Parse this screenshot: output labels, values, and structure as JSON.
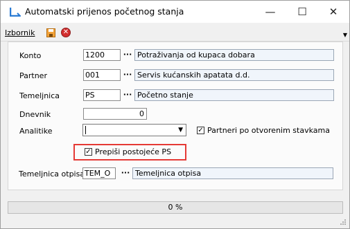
{
  "window": {
    "title": "Automatski prijenos početnog stanja"
  },
  "titlebar": {
    "minimize": "—",
    "maximize": "☐",
    "close": "✕"
  },
  "menu": {
    "izbornik": "Izbornik"
  },
  "form": {
    "konto": {
      "label": "Konto",
      "code": "1200",
      "ellipsis": "···",
      "desc": "Potraživanja od kupaca dobara"
    },
    "partner": {
      "label": "Partner",
      "code": "001",
      "ellipsis": "···",
      "desc": "Servis kućanskih apatata d.d."
    },
    "temeljnica": {
      "label": "Temeljnica",
      "code": "PS",
      "ellipsis": "···",
      "desc": "Početno stanje"
    },
    "dnevnik": {
      "label": "Dnevnik",
      "value": "0"
    },
    "analitike": {
      "label": "Analitike",
      "value": "",
      "arrow": "▼"
    },
    "partneri_checkbox": {
      "label": "Partneri po otvorenim stavkama",
      "checked": true,
      "mark": "✓"
    },
    "prepisi_checkbox": {
      "label": "Prepiši postojeće PS",
      "checked": true,
      "mark": "✓"
    },
    "temeljnica_otpisa": {
      "label": "Temeljnica otpisa",
      "code": "TEM_O",
      "ellipsis": "···",
      "desc": "Temeljnica otpisa"
    }
  },
  "status": {
    "progress_text": "0 %",
    "progress_fraction": 0
  },
  "colors": {
    "highlight": "#e53935",
    "field_bg": "#f0f5fb",
    "title_icon": "#2a7bd4"
  }
}
